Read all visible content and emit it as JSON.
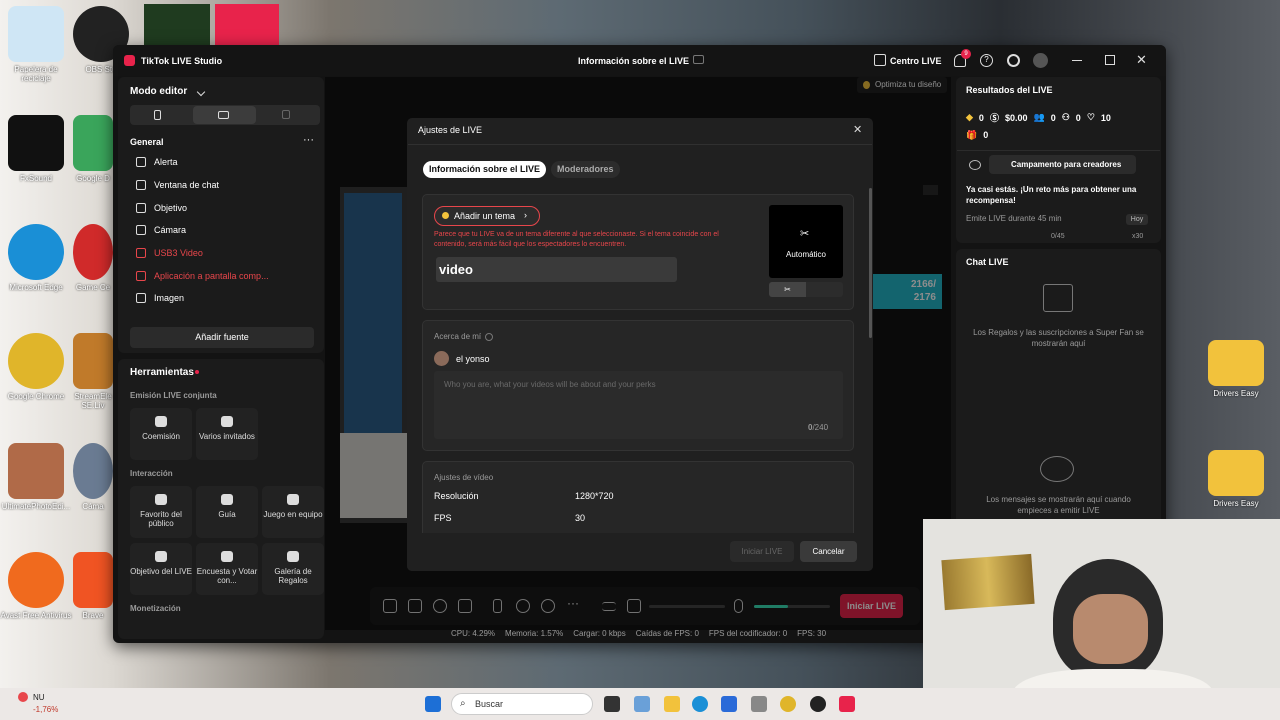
{
  "desktop": {
    "icons": [
      {
        "label": "Papelera de reciclaje"
      },
      {
        "label": "OBS Stu"
      },
      {
        "label": "FxSound"
      },
      {
        "label": "Google D"
      },
      {
        "label": "Microsoft Edge"
      },
      {
        "label": "Game Ce"
      },
      {
        "label": "Google Chrome"
      },
      {
        "label": "StreamEle SE.Liv"
      },
      {
        "label": "UltimatePhotoEdi..."
      },
      {
        "label": "Cáma"
      },
      {
        "label": "Avast Free Antivirus"
      },
      {
        "label": "Brave"
      },
      {
        "label": "Drivers Easy"
      },
      {
        "label": "Drivers Easy"
      }
    ]
  },
  "window": {
    "app_title": "TikTok LIVE Studio",
    "center_title": "Información sobre el LIVE",
    "centro_live": "Centro LIVE",
    "notif_count": "9"
  },
  "left": {
    "mode_title": "Modo editor",
    "general": "General",
    "sources": [
      "Alerta",
      "Ventana de chat",
      "Objetivo",
      "Cámara",
      "USB3 Video",
      "Aplicación a pantalla comp...",
      "Imagen"
    ],
    "add_source": "Añadir fuente",
    "tools_title": "Herramientas",
    "joint_title": "Emisión LIVE conjunta",
    "joint_tools": [
      "Coemisión",
      "Varios invitados"
    ],
    "interaction_title": "Interacción",
    "interaction_tools": [
      "Favorito del público",
      "Guía",
      "Juego en equipo",
      "Objetivo del LIVE",
      "Encuesta y Votar con...",
      "Galería de Regalos"
    ],
    "monetization_title": "Monetización"
  },
  "preview": {
    "optimize": "Optimiza tu diseño",
    "counter": "2166/\n2176"
  },
  "modal": {
    "title": "Ajustes de LIVE",
    "tabs": [
      "Información sobre el LIVE",
      "Moderadores"
    ],
    "add_topic": "Añadir un tema",
    "warning": "Parece que tu LIVE va de un tema diferente al que seleccionaste. Si el tema coincide con el contenido, será más fácil que los espectadores lo encuentren.",
    "title_value": "video",
    "cover_label": "Automático",
    "about_title": "Acerca de mí",
    "user_name": "el yonso",
    "about_placeholder": "Who you are, what your videos will be about and your perks",
    "char_count": "0",
    "char_max": "/240",
    "video_title": "Ajustes de vídeo",
    "res_label": "Resolución",
    "res_value": "1280*720",
    "fps_label": "FPS",
    "fps_value": "30",
    "start_btn": "Iniciar LIVE",
    "cancel_btn": "Cancelar"
  },
  "bottombar": {
    "start": "Iniciar LIVE",
    "mic_level": 0.45,
    "stats": {
      "cpu": "CPU: 4.29%",
      "mem": "Memoria: 1.57%",
      "load": "Cargar: 0 kbps",
      "fps_drop": "Caídas de FPS: 0",
      "enc": "FPS del codificador: 0",
      "fps": "FPS: 30"
    }
  },
  "right": {
    "results_title": "Resultados del LIVE",
    "stats": [
      "0",
      "$0.00",
      "0",
      "0",
      "10",
      "0"
    ],
    "camp": "Campamento para creadores",
    "challenge": "Ya casi estás. ¡Un reto más para obtener una recompensa!",
    "emit": "Emite LIVE durante 45 min",
    "today": "Hoy",
    "progress": "0/45",
    "reward": "x30",
    "chat_title": "Chat LIVE",
    "gifts_msg": "Los Regalos y las suscripciones a Super Fan se mostrarán aquí",
    "chat_msg": "Los mensajes se mostrarán aquí cuando empieces a emitir LIVE"
  },
  "taskbar": {
    "ticker_name": "NU",
    "ticker_value": "-1,76%",
    "search": "Buscar"
  }
}
